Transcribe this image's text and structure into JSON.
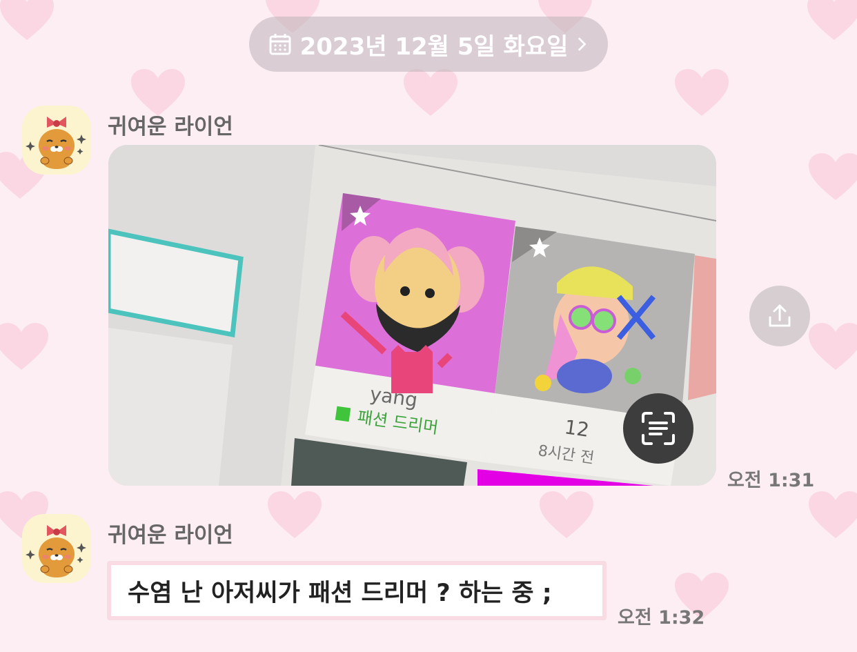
{
  "date_divider": {
    "label": "2023년 12월 5일 화요일"
  },
  "messages": [
    {
      "sender": "귀여운 라이언",
      "type": "image",
      "time": "오전 1:31",
      "image_text": {
        "card1_name": "yang",
        "card1_tag": "패션 드리머",
        "card2_count": "12",
        "card2_ago": "8시간 전"
      }
    },
    {
      "sender": "귀여운 라이언",
      "type": "text",
      "text": "수염 난 아저씨가 패션 드리머 ? 하는 중 ;",
      "time": "오전 1:32"
    }
  ],
  "icons": {
    "date": "calendar-icon",
    "date_arrow": "chevron-right-icon",
    "share": "share-icon",
    "scan": "text-scan-icon",
    "avatar": "ryan-avatar"
  },
  "colors": {
    "background": "#fdeef3",
    "heart": "#f8c6d6",
    "bubble_border": "#f9dbe3"
  }
}
